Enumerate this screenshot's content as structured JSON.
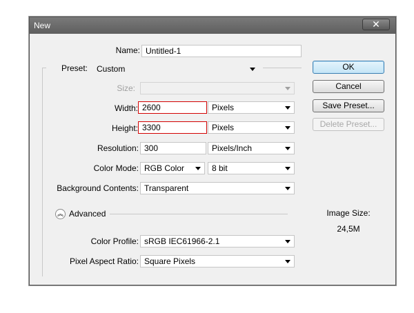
{
  "window": {
    "title": "New",
    "close_glyph": "✕"
  },
  "form": {
    "name": {
      "label": "Name:",
      "value": "Untitled-1"
    },
    "preset": {
      "label": "Preset:",
      "value": "Custom"
    },
    "size": {
      "label": "Size:",
      "value": ""
    },
    "width": {
      "label": "Width:",
      "value": "2600",
      "unit": "Pixels"
    },
    "height": {
      "label": "Height:",
      "value": "3300",
      "unit": "Pixels"
    },
    "resolution": {
      "label": "Resolution:",
      "value": "300",
      "unit": "Pixels/Inch"
    },
    "color_mode": {
      "label": "Color Mode:",
      "value": "RGB Color",
      "depth": "8 bit"
    },
    "background": {
      "label": "Background Contents:",
      "value": "Transparent"
    },
    "advanced": {
      "label": "Advanced",
      "icon": "collapse-up-icon"
    },
    "color_profile": {
      "label": "Color Profile:",
      "value": "sRGB IEC61966-2.1"
    },
    "pixel_aspect": {
      "label": "Pixel Aspect Ratio:",
      "value": "Square Pixels"
    }
  },
  "buttons": {
    "ok": "OK",
    "cancel": "Cancel",
    "save_preset": "Save Preset...",
    "delete_preset": "Delete Preset..."
  },
  "image_size": {
    "label": "Image Size:",
    "value": "24,5M"
  },
  "colors": {
    "titlebar": "#6a6a6a",
    "background": "#f0f0f0",
    "highlight_border": "#d30000",
    "ok_border": "#3c7fb1"
  }
}
